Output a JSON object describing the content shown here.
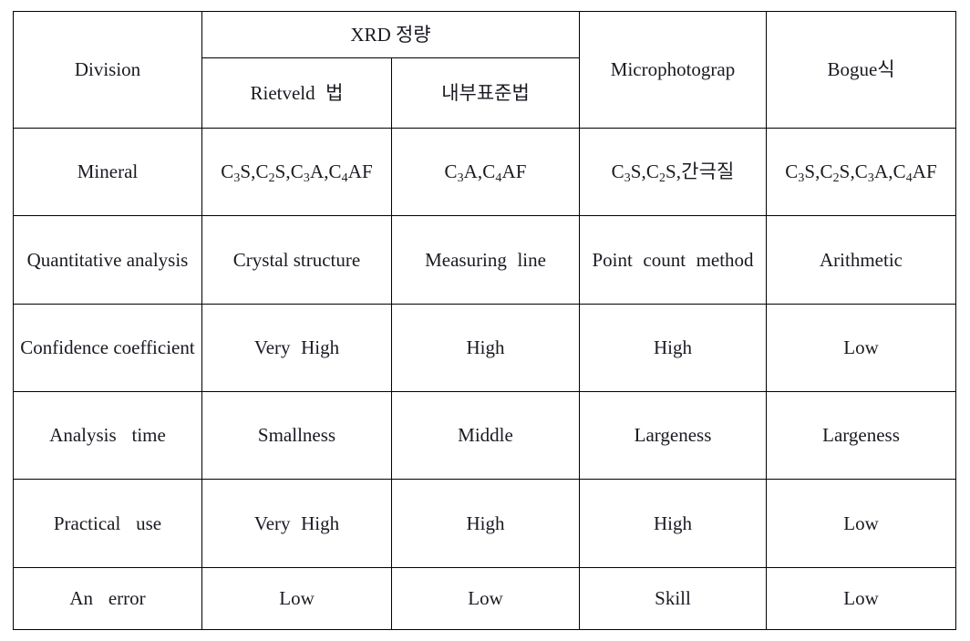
{
  "table": {
    "columns": [
      {
        "key": "division",
        "label": "Division"
      },
      {
        "key": "rietveld",
        "label": "Rietveld 법"
      },
      {
        "key": "internal",
        "label": "내부표준법"
      },
      {
        "key": "micro",
        "label": "Microphotograp"
      },
      {
        "key": "bogue",
        "label": "Bogue식"
      }
    ],
    "group_header": {
      "xrd": "XRD 정량"
    },
    "rows": [
      {
        "label": "Mineral",
        "cells": [
          {
            "text": "C3S,C2S,C3A,C4AF",
            "parts": [
              "C",
              "3",
              "S,C",
              "2",
              "S,C",
              "3",
              "A,C",
              "4",
              "AF"
            ]
          },
          {
            "text": "C3A,C4AF",
            "parts": [
              "C",
              "3",
              "A,C",
              "4",
              "AF"
            ]
          },
          {
            "text": "C3S,C2S,간극질",
            "parts": [
              "C",
              "3",
              "S,C",
              "2",
              "S,간극질"
            ]
          },
          {
            "text": "C3S,C2S,C3A,C4AF",
            "parts": [
              "C",
              "3",
              "S,C",
              "2",
              "S,C",
              "3",
              "A,C",
              "4",
              "AF"
            ]
          }
        ]
      },
      {
        "label": "Quantitative analysis",
        "cells": [
          {
            "text": "Crystal structure"
          },
          {
            "text": "Measuring line"
          },
          {
            "text": "Point count method"
          },
          {
            "text": "Arithmetic"
          }
        ]
      },
      {
        "label": "Confidence coefficient",
        "cells": [
          {
            "text": "Very High"
          },
          {
            "text": "High"
          },
          {
            "text": "High"
          },
          {
            "text": "Low"
          }
        ]
      },
      {
        "label": "Analysis time",
        "cells": [
          {
            "text": "Smallness"
          },
          {
            "text": "Middle"
          },
          {
            "text": "Largeness"
          },
          {
            "text": "Largeness"
          }
        ]
      },
      {
        "label": "Practical use",
        "cells": [
          {
            "text": "Very High"
          },
          {
            "text": "High"
          },
          {
            "text": "High"
          },
          {
            "text": "Low"
          }
        ]
      },
      {
        "label": "An error",
        "cells": [
          {
            "text": "Low"
          },
          {
            "text": "Low"
          },
          {
            "text": "Skill"
          },
          {
            "text": "Low"
          }
        ]
      }
    ]
  },
  "style": {
    "border_color": "#000000",
    "text_color": "#1a1a22",
    "background": "#ffffff"
  }
}
